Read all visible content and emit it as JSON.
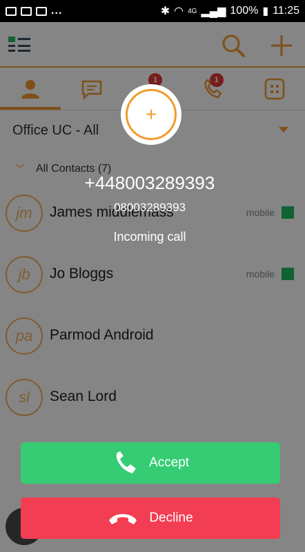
{
  "status_bar": {
    "dots": "...",
    "battery": "100%",
    "time": "11:25",
    "network": "4G"
  },
  "tabs": [
    {
      "name": "contacts",
      "badge": ""
    },
    {
      "name": "chat",
      "badge": ""
    },
    {
      "name": "voicemail",
      "badge": "1"
    },
    {
      "name": "calls",
      "badge": "1"
    },
    {
      "name": "dialpad",
      "badge": ""
    }
  ],
  "filter": {
    "title": "Office UC -  All"
  },
  "group": {
    "label": "All Contacts (7)"
  },
  "contacts": [
    {
      "initials": "jm",
      "name": "James middlemass",
      "type": "mobile",
      "status_color": "#1fbb64"
    },
    {
      "initials": "jb",
      "name": "Jo Bloggs",
      "type": "mobile",
      "status_color": "#1fbb64"
    },
    {
      "initials": "pa",
      "name": "Parmod Android",
      "type": "",
      "status_color": ""
    },
    {
      "initials": "sl",
      "name": "Sean Lord",
      "type": "",
      "status_color": ""
    }
  ],
  "incoming_call": {
    "number": "+448003289393",
    "sub_number": "08003289393",
    "status": "Incoming call",
    "accept_label": "Accept",
    "decline_label": "Decline"
  },
  "colors": {
    "accent": "#f29a2e",
    "accept": "#35cc74",
    "decline": "#f23d52",
    "presence_available": "#1fbb64"
  }
}
